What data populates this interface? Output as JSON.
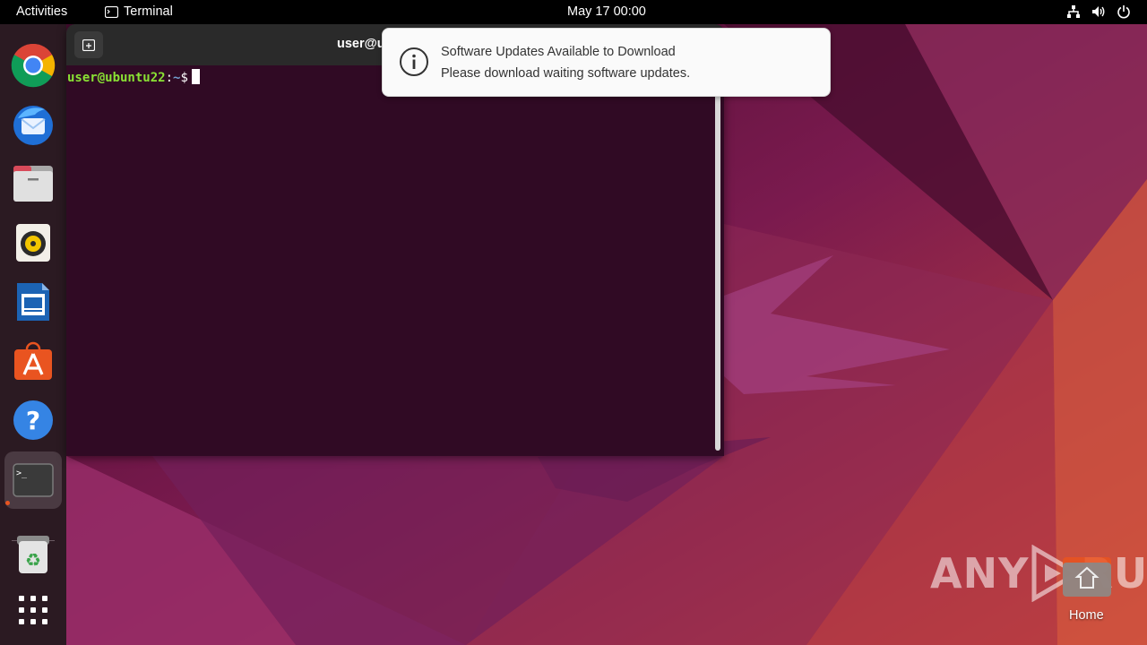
{
  "topbar": {
    "activities": "Activities",
    "app_name": "Terminal",
    "clock": "May 17  00:00",
    "tray_icons": [
      "network-icon",
      "volume-icon",
      "power-icon"
    ]
  },
  "dock": {
    "items": [
      {
        "name": "chrome",
        "icon": "chrome-icon"
      },
      {
        "name": "thunderbird",
        "icon": "thunderbird-icon"
      },
      {
        "name": "files",
        "icon": "files-icon"
      },
      {
        "name": "rhythmbox",
        "icon": "rhythmbox-icon"
      },
      {
        "name": "libreoffice-writer",
        "icon": "writer-icon"
      },
      {
        "name": "software-center",
        "icon": "app-store-icon"
      },
      {
        "name": "help",
        "icon": "help-icon"
      },
      {
        "name": "terminal",
        "icon": "terminal-icon",
        "running": true
      },
      {
        "name": "trash",
        "icon": "trash-icon"
      },
      {
        "name": "show-apps",
        "icon": "app-grid-icon"
      }
    ]
  },
  "terminal": {
    "title": "user@u",
    "prompt_user": "user@ubuntu22",
    "prompt_sep": ":",
    "prompt_path": "~",
    "prompt_symbol": "$"
  },
  "notification": {
    "title": "Software Updates Available to Download",
    "body": "Please download waiting software updates."
  },
  "desktop": {
    "home_label": "Home"
  },
  "watermark": {
    "left": "ANY",
    "right": "RUN"
  },
  "colors": {
    "terminal_bg": "#300a24",
    "accent": "#e95420",
    "prompt_user": "#8ae234",
    "prompt_path": "#729fcf"
  }
}
